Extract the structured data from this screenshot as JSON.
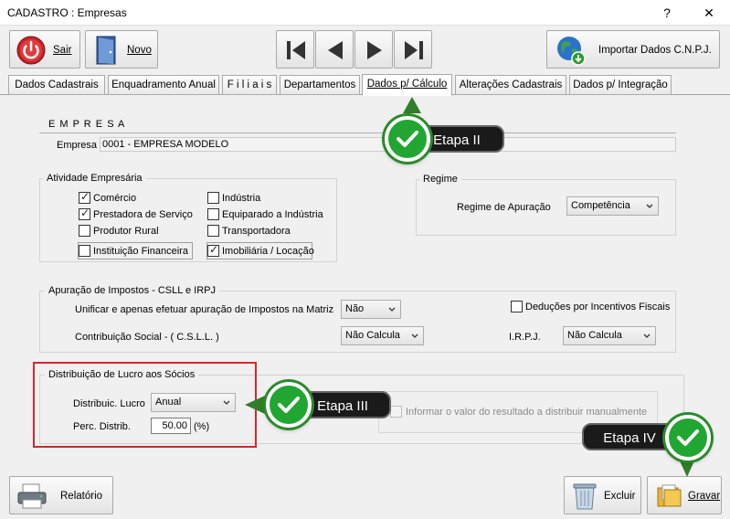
{
  "window": {
    "title": "CADASTRO : Empresas",
    "help_label": "?",
    "close_label": "✕"
  },
  "toolbar": {
    "sair_label": "Sair",
    "novo_label": "Novo",
    "importar_label": "Importar Dados C.N.P.J."
  },
  "tabs": [
    {
      "label": "Dados  Cadastrais"
    },
    {
      "label": "Enquadramento Anual"
    },
    {
      "label": "F i l i a i s"
    },
    {
      "label": "Departamentos"
    },
    {
      "label": "Dados p/ Cálculo"
    },
    {
      "label": "Alterações Cadastrais"
    },
    {
      "label": "Dados p/ Integração"
    }
  ],
  "empresa": {
    "heading": "E M P R E S A",
    "label": "Empresa",
    "value": "0001 - EMPRESA MODELO"
  },
  "atividade": {
    "title": "Atividade Empresária",
    "items": [
      {
        "label": "Comércio",
        "checked": true
      },
      {
        "label": "Indústria",
        "checked": false
      },
      {
        "label": "Prestadora de Serviço",
        "checked": true
      },
      {
        "label": "Equiparado a Indústria",
        "checked": false
      },
      {
        "label": "Produtor Rural",
        "checked": false
      },
      {
        "label": "Transportadora",
        "checked": false
      },
      {
        "label": "Instituição Financeira",
        "checked": false
      },
      {
        "label": "Imobiliária / Locação",
        "checked": true
      }
    ]
  },
  "regime": {
    "title": "Regime",
    "apuracao_label": "Regime de Apuração",
    "apuracao_value": "Competência"
  },
  "impostos": {
    "title": "Apuração de Impostos - CSLL e IRPJ",
    "unificar_label": "Unificar e apenas efetuar apuração de Impostos na Matriz",
    "unificar_value": "Não",
    "deducoes_label": "Deduções por Incentivos Fiscais",
    "csll_label": "Contribuição Social - ( C.S.L.L. )",
    "csll_value": "Não Calcula",
    "irpj_label": "I.R.P.J.",
    "irpj_value": "Não Calcula"
  },
  "distribuicao": {
    "title": "Distribuição de Lucro aos Sócios",
    "lucro_label": "Distribuic. Lucro",
    "lucro_value": "Anual",
    "perc_label": "Perc. Distrib.",
    "perc_value": "50.00",
    "perc_unit": "(%)",
    "informar_label": "Informar o valor do resultado a distribuir manualmente"
  },
  "annotations": {
    "etapa2": "Etapa II",
    "etapa3": "Etapa III",
    "etapa4": "Etapa IV"
  },
  "bottom": {
    "relatorio_label": "Relatório",
    "excluir_label": "Excluir",
    "gravar_label": "Gravar"
  },
  "colors": {
    "annotation_green": "#22a632",
    "highlight_red": "#d9262c",
    "active_tab_bg": "#ffffff"
  }
}
